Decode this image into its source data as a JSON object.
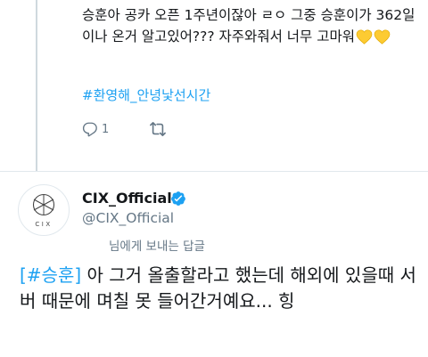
{
  "parent_tweet": {
    "text": "승훈아 공카 오픈 1주년이잖아 ㄹㅇ 그중 승훈이가 362일이나 온거 알고있어??? 자주와줘서 너무 고마워",
    "emoji": "yellow-heart-emoji",
    "hashtag": "#환영해_안녕낯선시간",
    "reply_count": "1",
    "colors": {
      "link": "#1da1f2",
      "muted": "#657786",
      "text": "#14171a"
    }
  },
  "reply_tweet": {
    "display_name": "CIX_Official",
    "handle": "@CIX_Official",
    "verified": true,
    "avatar_logo_text": "CIX",
    "reply_context": "님에게 보내는 답글",
    "body_tag": "[#승훈]",
    "body_text": " 아 그거 올출할라고 했는데 해외에 있을때 서버 때문에 며칠 못 들어간거예요... 힝"
  }
}
